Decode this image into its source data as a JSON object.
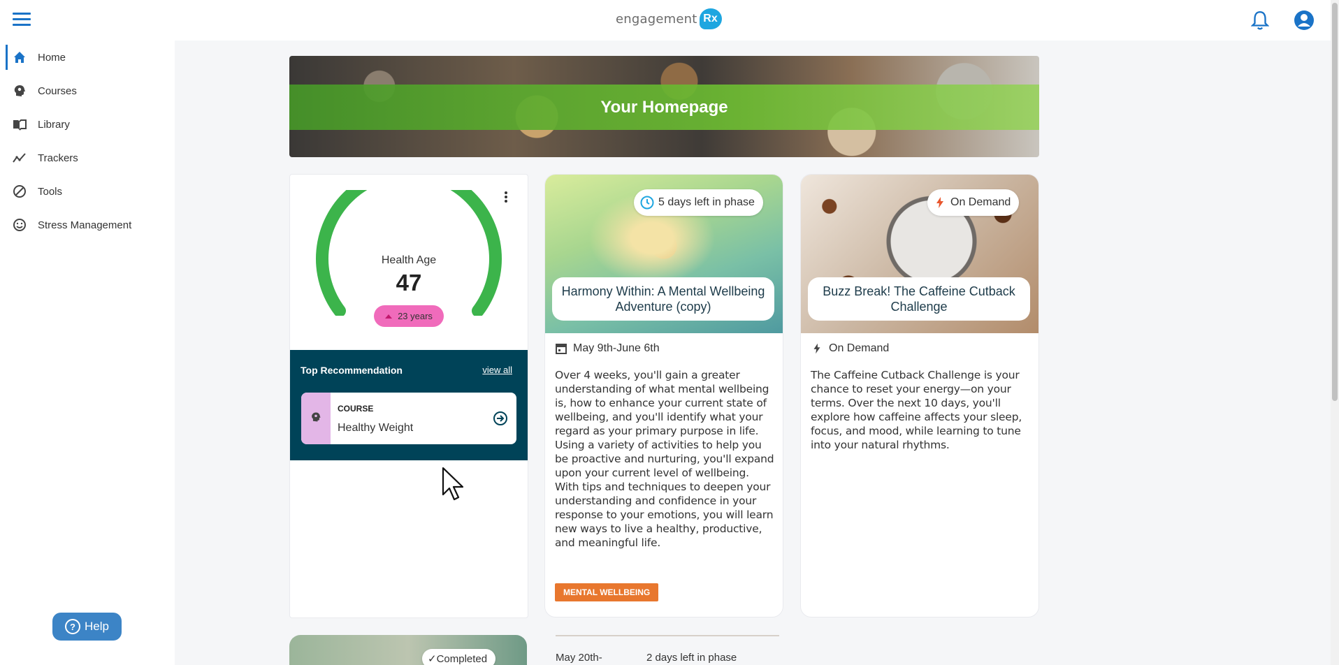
{
  "app": {
    "logo_text": "engagement",
    "logo_badge": "Rx"
  },
  "sidebar": {
    "items": [
      {
        "label": "Home",
        "icon": "home-icon",
        "active": true
      },
      {
        "label": "Courses",
        "icon": "head-gear-icon"
      },
      {
        "label": "Library",
        "icon": "book-icon"
      },
      {
        "label": "Trackers",
        "icon": "trend-icon"
      },
      {
        "label": "Tools",
        "icon": "circle-slash-icon"
      },
      {
        "label": "Stress Management",
        "icon": "smiley-icon"
      }
    ],
    "help_label": "Help"
  },
  "hero": {
    "title": "Your Homepage"
  },
  "health_card": {
    "label": "Health Age",
    "value": "47",
    "badge": "23 years",
    "gauge_color": "#3cb44b",
    "badge_color": "#f06bbb"
  },
  "recommendation": {
    "title": "Top Recommendation",
    "view_all": "view all",
    "item": {
      "kind": "COURSE",
      "name": "Healthy Weight"
    }
  },
  "cards": [
    {
      "pill": "5 days left in phase",
      "title": "Harmony Within: A Mental Wellbeing Adventure (copy)",
      "meta": "May 9th-June 6th",
      "description": "Over 4 weeks, you'll gain a greater understanding of what mental wellbeing is, how to enhance your current state of wellbeing, and you'll identify what your regard as your primary purpose in life. Using a variety of activities to help you be proactive and nurturing, you'll expand upon your current level of wellbeing. With tips and techniques to deepen your understanding and confidence in your response to your emotions, you will learn new ways to live a healthy, productive, and meaningful life.",
      "tag": "MENTAL WELLBEING",
      "tag_color": "#e8772e"
    },
    {
      "pill": "On Demand",
      "title": "Buzz Break! The Caffeine Cutback Challenge",
      "meta": "On Demand",
      "description": "The Caffeine Cutback Challenge is your chance to reset your energy—on your terms. Over the next 10 days, you'll explore how caffeine affects your sleep, focus, and mood, while learning to tune into your natural rhythms."
    }
  ],
  "peek": {
    "pill": "Completed",
    "meta": "May 20th-",
    "pill2": "2 days left in phase"
  }
}
